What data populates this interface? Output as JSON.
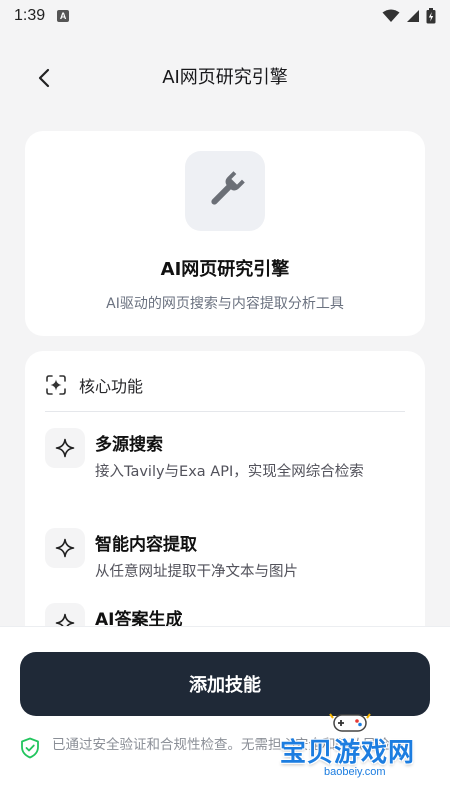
{
  "status_bar": {
    "time": "1:39",
    "notification_letter": "A"
  },
  "header": {
    "title": "AI网页研究引擎"
  },
  "hero": {
    "icon": "wrench-icon",
    "title": "AI网页研究引擎",
    "subtitle": "AI驱动的网页搜索与内容提取分析工具"
  },
  "features": {
    "section_icon": "scan-sparkle-icon",
    "title": "核心功能",
    "items": [
      {
        "icon": "sparkle-icon",
        "title": "多源搜索",
        "desc": "接入Tavily与Exa API，实现全网综合检索"
      },
      {
        "icon": "sparkle-icon",
        "title": "智能内容提取",
        "desc": "从任意网址提取干净文本与图片"
      },
      {
        "icon": "sparkle-icon",
        "title": "AI答案生成",
        "desc": ""
      }
    ]
  },
  "bottom": {
    "primary_button": "添加技能",
    "security_note": "已通过安全验证和合规性检查。无需担心安全和隐私风险。"
  },
  "watermark": {
    "main": "宝贝游戏网",
    "sub": "baobeiy.com"
  },
  "colors": {
    "page_bg": "#f4f4f5",
    "primary_button_bg": "#1f2937",
    "security_green": "#22c55e",
    "watermark_blue": "#1c7de0"
  }
}
